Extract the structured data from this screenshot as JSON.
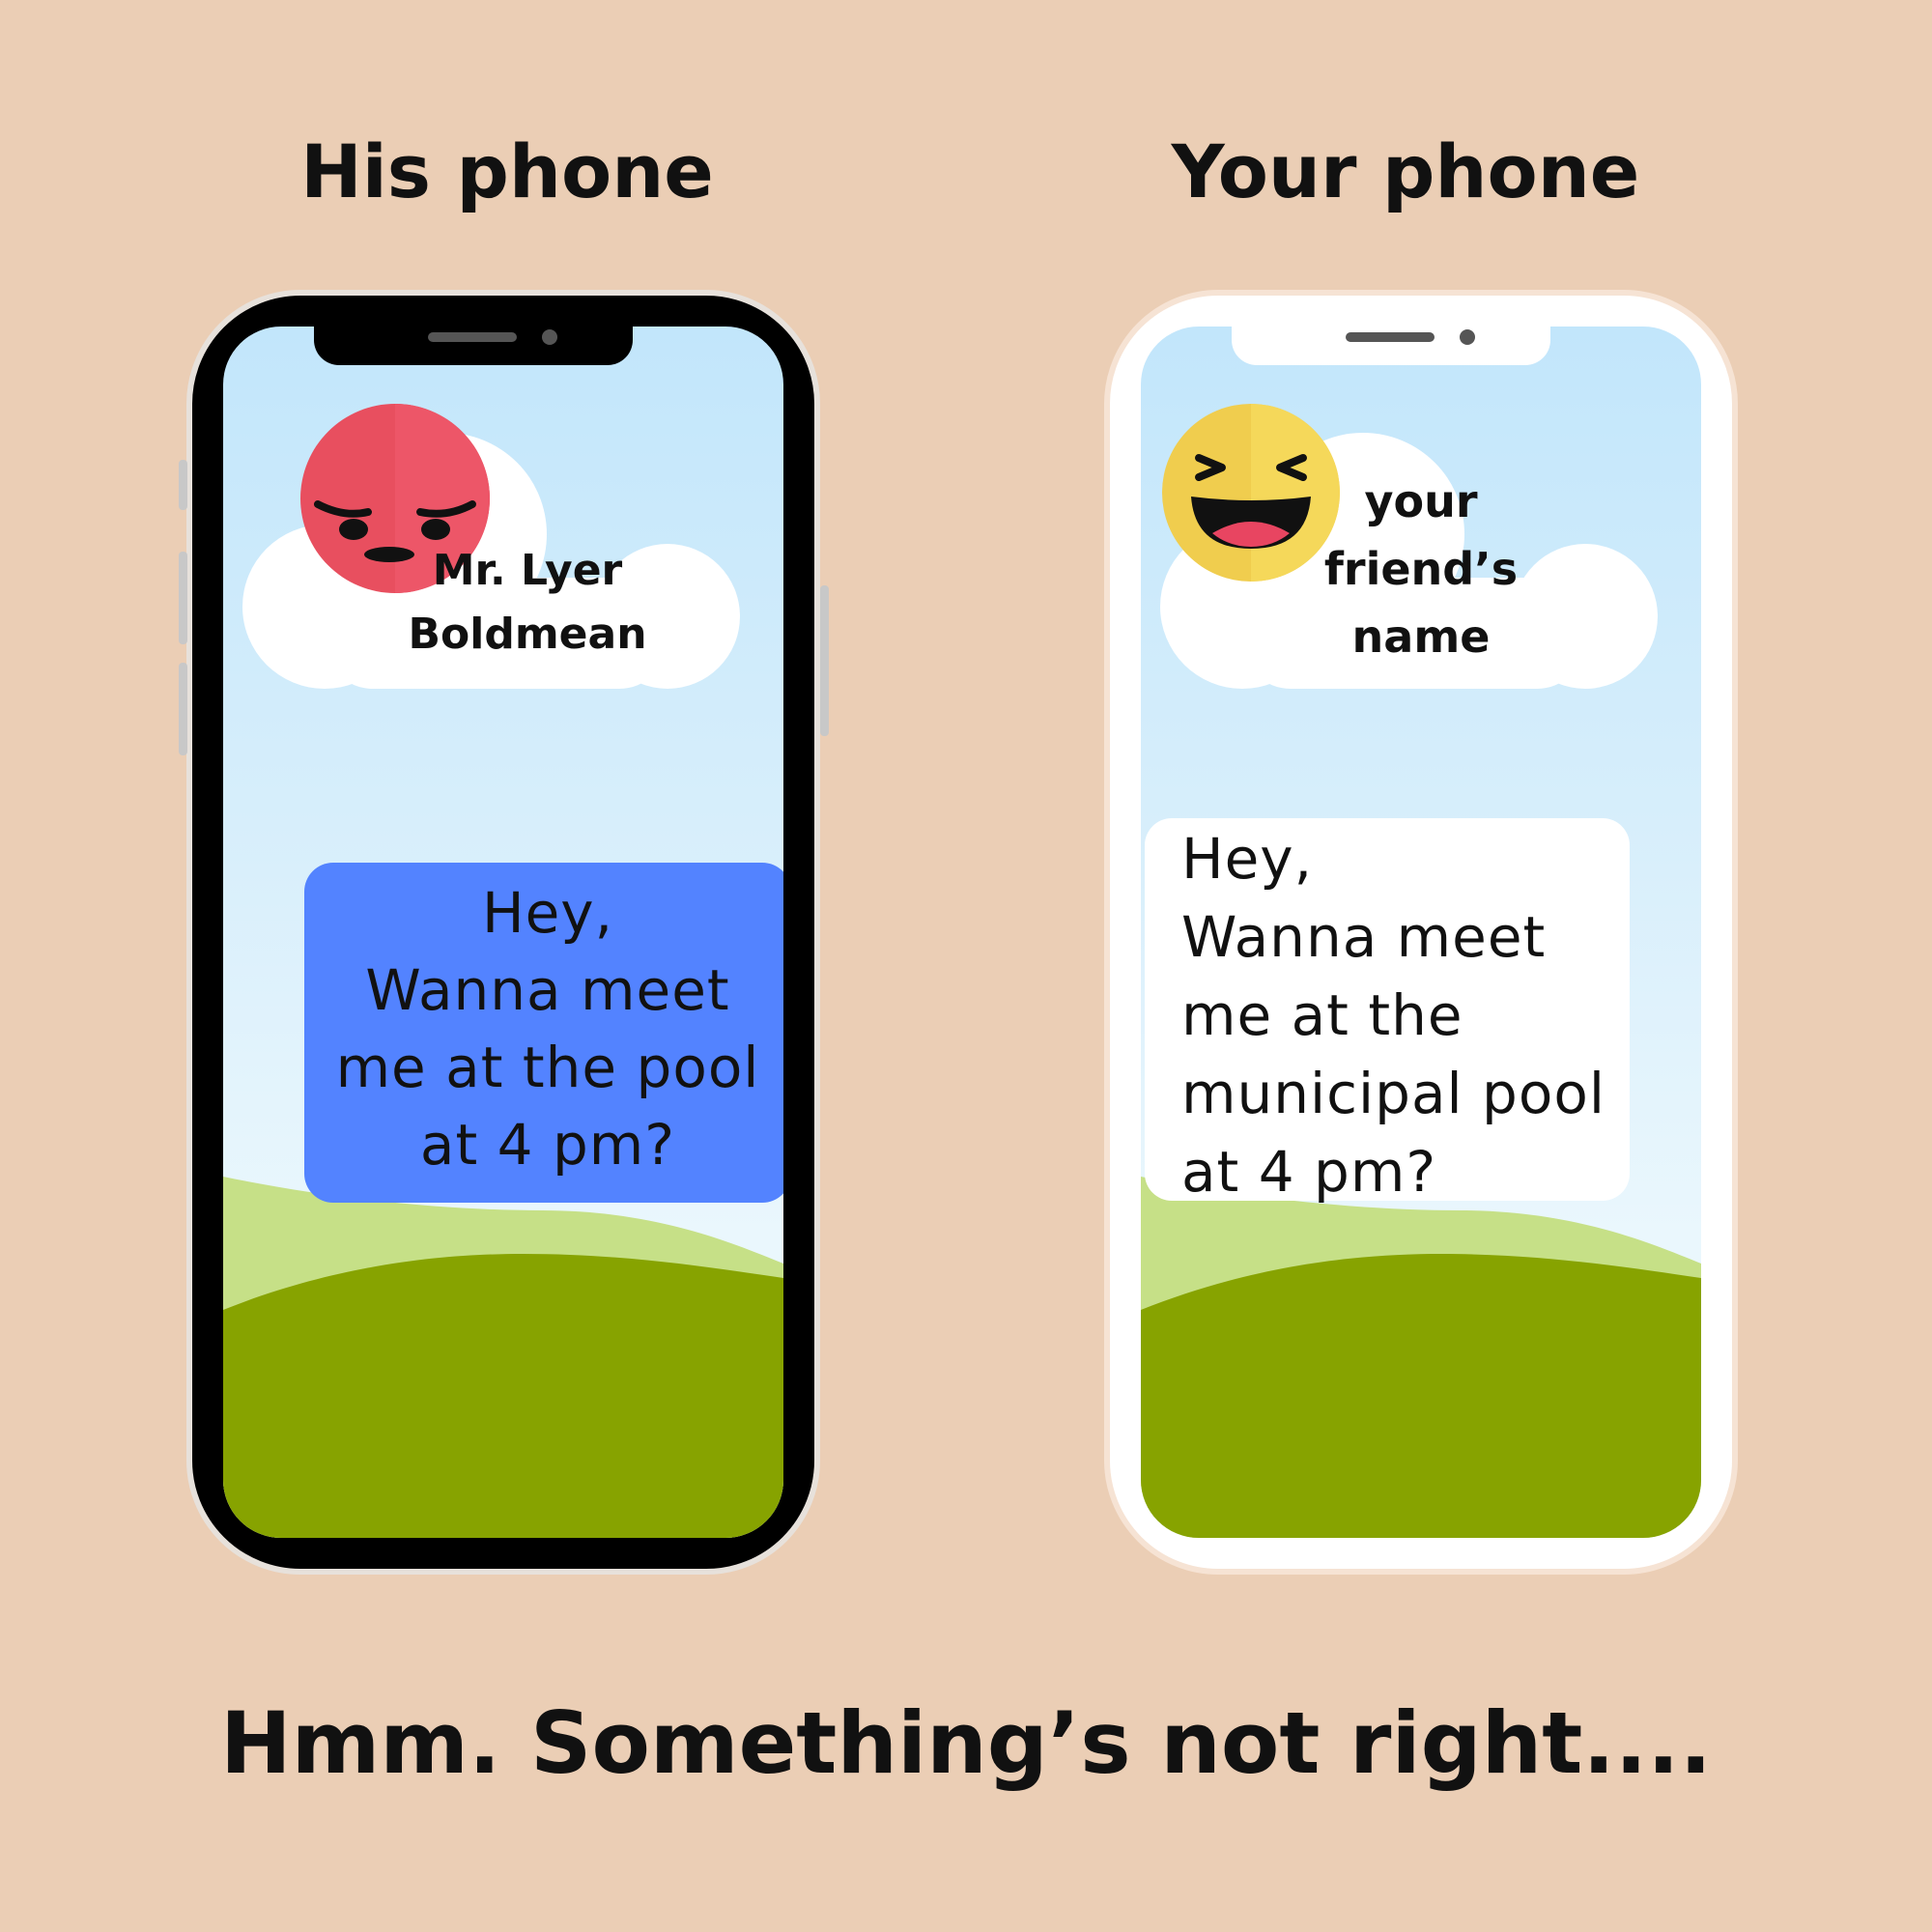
{
  "headings": {
    "his_phone": "His phone",
    "your_phone": "Your phone",
    "caption": "Hmm. Something’s not right...."
  },
  "his_phone": {
    "contact_name": "Mr. Lyer\nBoldmean",
    "emoji": "angry-face-icon",
    "message": "Hey,\nWanna meet\nme at the pool\nat 4 pm?",
    "bubble_color": "#5383ff",
    "frame_color": "#000000"
  },
  "your_phone": {
    "contact_name": "your\nfriend’s\nname",
    "emoji": "laughing-face-icon",
    "message": "Hey,\nWanna meet\nme at the\nmunicipal pool\nat 4 pm?",
    "bubble_color": "#ffffff",
    "frame_color": "#ffffff"
  },
  "colors": {
    "background": "#ebceb5",
    "sky": "#c2e6fb",
    "hill_light": "#c6e087",
    "hill_dark": "#87a300"
  }
}
